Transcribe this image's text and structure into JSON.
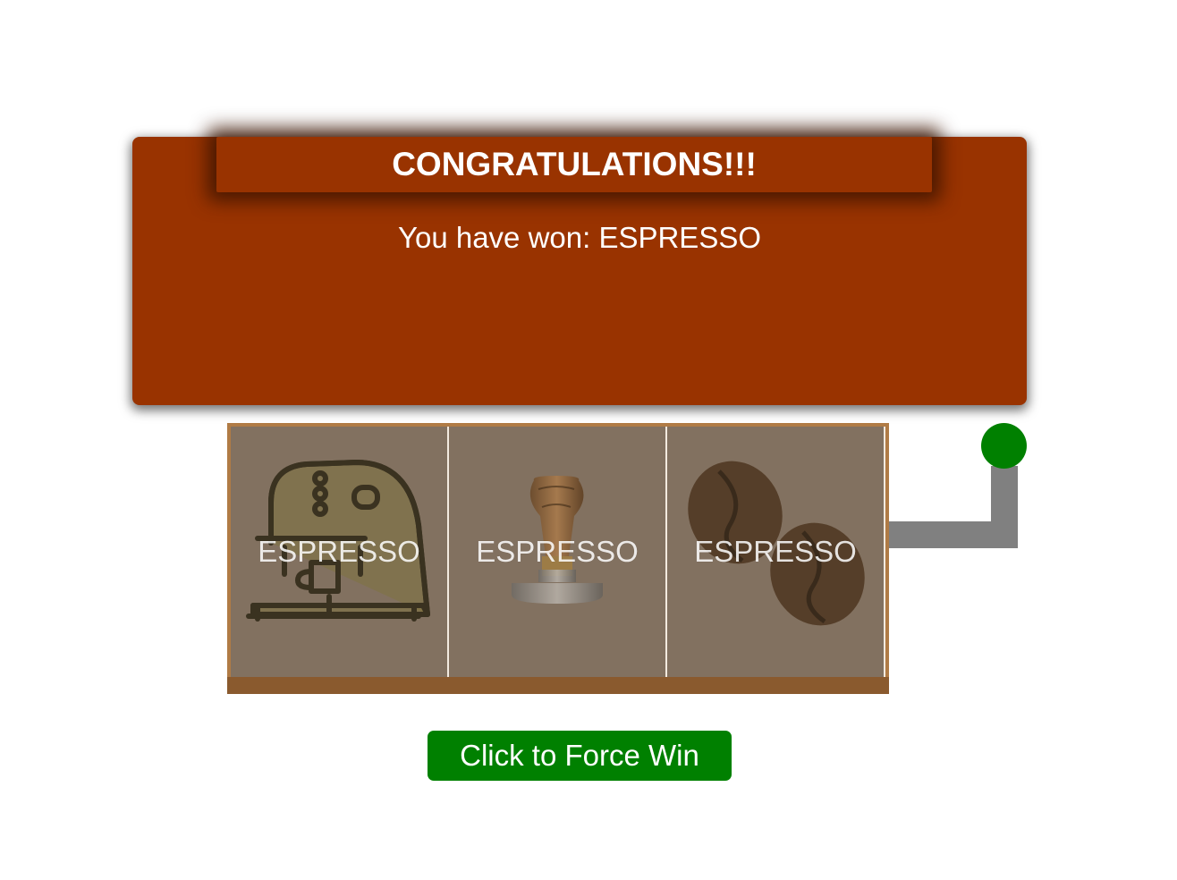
{
  "popup": {
    "title": "CONGRATULATIONS!!!",
    "message": "You have won: ESPRESSO"
  },
  "reels": [
    {
      "label": "ESPRESSO",
      "icon": "espresso-machine-icon"
    },
    {
      "label": "ESPRESSO",
      "icon": "coffee-tamper-icon"
    },
    {
      "label": "ESPRESSO",
      "icon": "coffee-beans-icon"
    }
  ],
  "lever": {
    "icon": "lever-knob"
  },
  "force_win_button": {
    "label": "Click to Force Win"
  },
  "colors": {
    "popup_bg": "#993300",
    "reel_bg": "#827160",
    "frame": "#b07b45",
    "lever": "#808080",
    "accent_green": "#008000"
  }
}
